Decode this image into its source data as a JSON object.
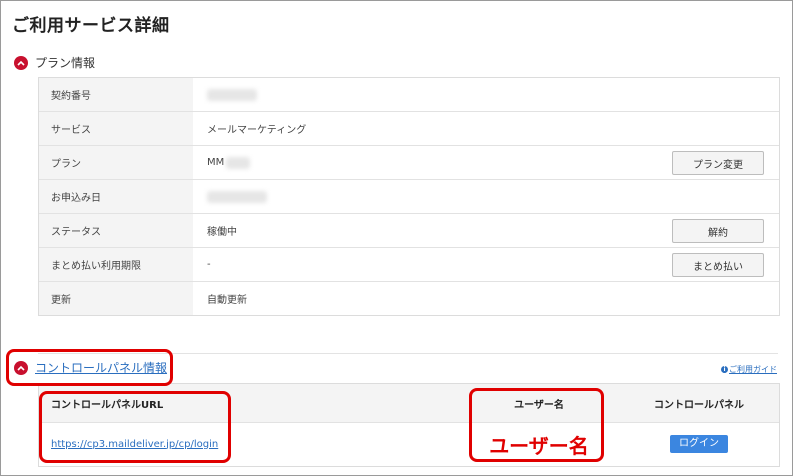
{
  "page_title": "ご利用サービス詳細",
  "plan_section": {
    "title": "プラン情報",
    "rows": [
      {
        "label": "契約番号",
        "value": "",
        "blurred": true
      },
      {
        "label": "サービス",
        "value": "メールマーケティング"
      },
      {
        "label": "プラン",
        "value": "MM",
        "button": "プラン変更"
      },
      {
        "label": "お申込み日",
        "value": "",
        "blurred": true
      },
      {
        "label": "ステータス",
        "value": "稼働中",
        "button": "解約"
      },
      {
        "label": "まとめ払い利用期限",
        "value": "-",
        "button": "まとめ払い"
      },
      {
        "label": "更新",
        "value": "自動更新"
      }
    ]
  },
  "control_section": {
    "title": "コントロールパネル情報",
    "guide_label": "ご利用ガイド",
    "headers": {
      "url": "コントロールパネルURL",
      "user": "ユーザー名",
      "panel": "コントロールパネル"
    },
    "row": {
      "url": "https://cp3.maildeliver.jp/cp/login",
      "user_annotation": "ユーザー名",
      "login_button": "ログイン"
    }
  },
  "colors": {
    "accent_red": "#c8102e",
    "annotation_red": "#e00000",
    "link_blue": "#2a6ebf",
    "button_blue": "#3b86e0"
  },
  "icons": {
    "toggle": "chevron-up-icon",
    "guide": "info-icon"
  }
}
